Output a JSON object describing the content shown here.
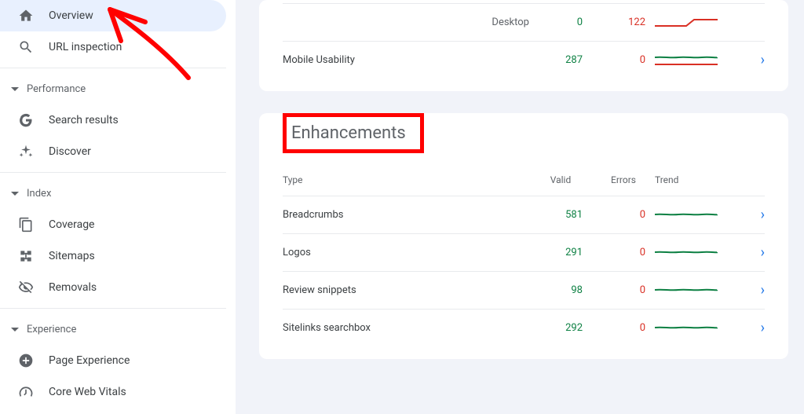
{
  "sidebar": {
    "overview": "Overview",
    "url_inspection": "URL inspection",
    "groups": {
      "performance": "Performance",
      "index": "Index",
      "experience": "Experience"
    },
    "search_results": "Search results",
    "discover": "Discover",
    "coverage": "Coverage",
    "sitemaps": "Sitemaps",
    "removals": "Removals",
    "page_experience": "Page Experience",
    "core_web_vitals": "Core Web Vitals"
  },
  "top_card": {
    "rows": [
      {
        "label": "Desktop",
        "valid": 0,
        "errors": 122
      },
      {
        "label": "Mobile Usability",
        "valid": 287,
        "errors": 0
      }
    ]
  },
  "enh": {
    "title": "Enhancements",
    "head": {
      "type": "Type",
      "valid": "Valid",
      "errors": "Errors",
      "trend": "Trend"
    },
    "rows": [
      {
        "label": "Breadcrumbs",
        "valid": 581,
        "errors": 0
      },
      {
        "label": "Logos",
        "valid": 291,
        "errors": 0
      },
      {
        "label": "Review snippets",
        "valid": 98,
        "errors": 0
      },
      {
        "label": "Sitelinks searchbox",
        "valid": 292,
        "errors": 0
      }
    ]
  },
  "chart_data": [
    {
      "type": "line",
      "title": "Desktop coverage trend",
      "series": [
        {
          "name": "errors",
          "color": "#d93025",
          "approx_values": [
            80,
            80,
            80,
            122,
            122
          ]
        }
      ]
    },
    {
      "type": "line",
      "title": "Mobile Usability trend",
      "series": [
        {
          "name": "valid",
          "color": "#0d8043",
          "approx_values": [
            285,
            287,
            286,
            288,
            287
          ]
        },
        {
          "name": "errors",
          "color": "#d93025",
          "approx_values": [
            0,
            0,
            0,
            0,
            0
          ]
        }
      ]
    },
    {
      "type": "line",
      "title": "Breadcrumbs trend",
      "series": [
        {
          "name": "valid",
          "color": "#0d8043",
          "approx_values": [
            578,
            581,
            579,
            582,
            581
          ]
        }
      ]
    },
    {
      "type": "line",
      "title": "Logos trend",
      "series": [
        {
          "name": "valid",
          "color": "#0d8043",
          "approx_values": [
            290,
            291,
            289,
            292,
            291
          ]
        }
      ]
    },
    {
      "type": "line",
      "title": "Review snippets trend",
      "series": [
        {
          "name": "valid",
          "color": "#0d8043",
          "approx_values": [
            96,
            98,
            97,
            99,
            98
          ]
        }
      ]
    },
    {
      "type": "line",
      "title": "Sitelinks searchbox trend",
      "series": [
        {
          "name": "valid",
          "color": "#0d8043",
          "approx_values": [
            290,
            292,
            291,
            293,
            292
          ]
        }
      ]
    }
  ]
}
